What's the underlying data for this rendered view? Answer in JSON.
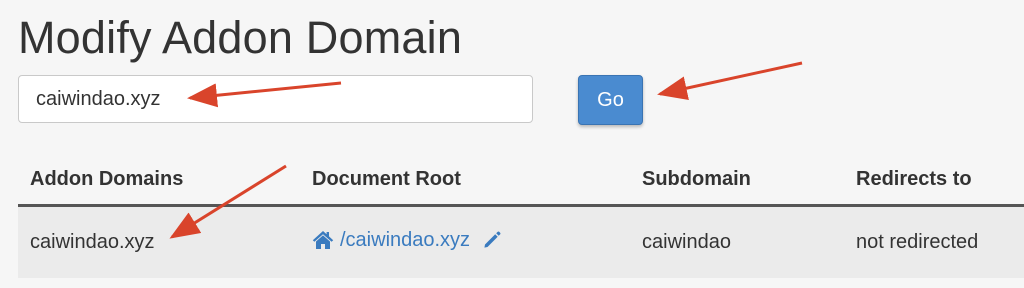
{
  "header": {
    "title": "Modify Addon Domain"
  },
  "search": {
    "value": "caiwindao.xyz",
    "go_label": "Go"
  },
  "table": {
    "columns": [
      "Addon Domains",
      "Document Root",
      "Subdomain",
      "Redirects to"
    ],
    "rows": [
      {
        "domain": "caiwindao.xyz",
        "document_root": "/caiwindao.xyz",
        "subdomain": "caiwindao",
        "redirects_to": "not redirected"
      }
    ]
  },
  "icons": {
    "document_root_icon": "home-icon",
    "edit_icon": "pencil-icon",
    "annotation": "red-arrow"
  },
  "colors": {
    "accent": "#4a8bd0",
    "link": "#3a7bbf",
    "annotation_arrow": "#d9442b"
  }
}
